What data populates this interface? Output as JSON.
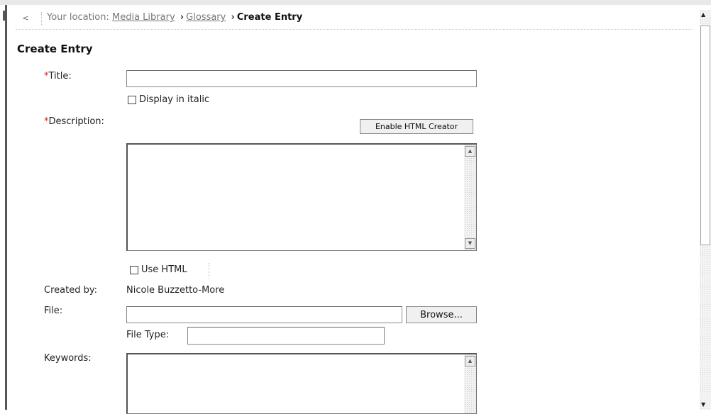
{
  "breadcrumb": {
    "prefix": "Your location:",
    "links": [
      "Media Library",
      "Glossary"
    ],
    "separator": "›",
    "current": "Create Entry"
  },
  "page": {
    "heading": "Create Entry"
  },
  "form": {
    "required_marker": "*",
    "title_label": "Title:",
    "title_value": "",
    "italic_label": "Display in italic",
    "description_label": "Description:",
    "html_creator_button": "Enable HTML Creator",
    "description_value": "",
    "use_html_label": "Use HTML",
    "created_by_label": "Created by:",
    "created_by_value": "Nicole Buzzetto-More",
    "file_label": "File:",
    "file_value": "",
    "browse_button": "Browse...",
    "file_type_label": "File Type:",
    "file_type_value": "",
    "keywords_label": "Keywords:",
    "keywords_value": ""
  },
  "icons": {
    "back": "left-chevron-icon",
    "scroll_up": "scroll-up-arrow-icon",
    "scroll_down": "scroll-down-arrow-icon"
  }
}
